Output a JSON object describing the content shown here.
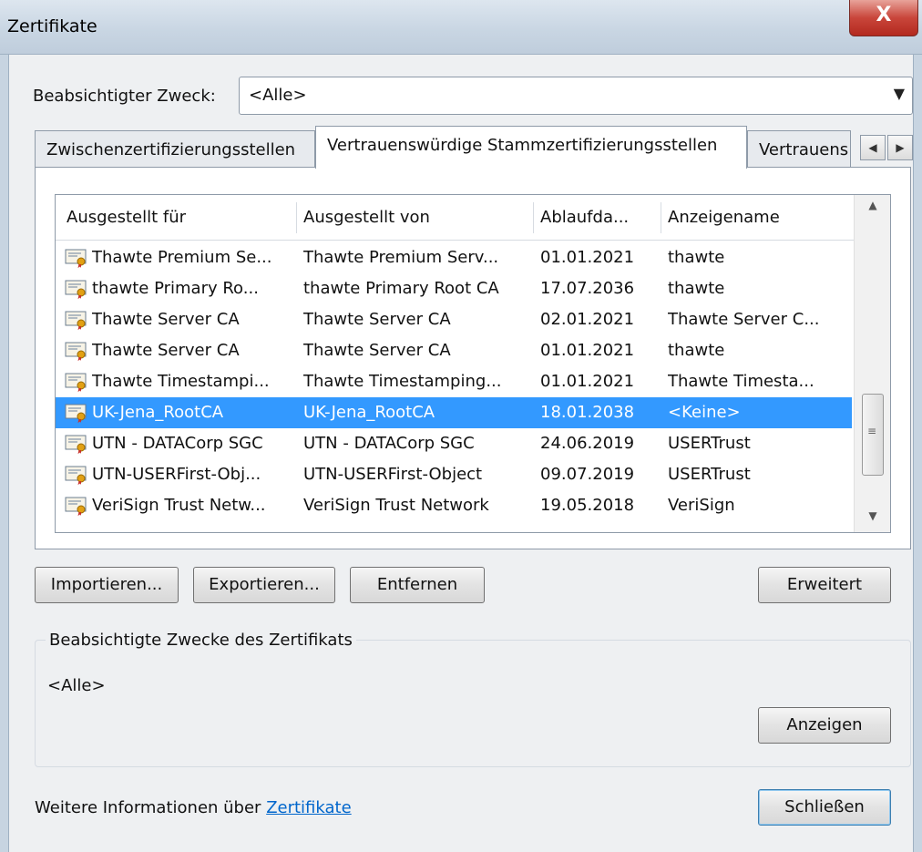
{
  "window": {
    "title": "Zertifikate",
    "close_glyph": "X"
  },
  "purpose": {
    "label": "Beabsichtigter Zweck:",
    "value": "<Alle>"
  },
  "tabs": [
    {
      "label": "Zwischenzertifizierungsstellen"
    },
    {
      "label": "Vertrauenswürdige Stammzertifizierungsstellen"
    },
    {
      "label": "Vertrauens"
    }
  ],
  "list": {
    "columns": [
      "Ausgestellt für",
      "Ausgestellt von",
      "Ablaufda...",
      "Anzeigename"
    ],
    "rows": [
      {
        "issued_to": "Thawte Premium Se...",
        "issued_by": "Thawte Premium Serv...",
        "expires": "01.01.2021",
        "name": "thawte"
      },
      {
        "issued_to": "thawte Primary Ro...",
        "issued_by": "thawte Primary Root CA",
        "expires": "17.07.2036",
        "name": "thawte"
      },
      {
        "issued_to": "Thawte Server CA",
        "issued_by": "Thawte Server CA",
        "expires": "02.01.2021",
        "name": "Thawte Server C..."
      },
      {
        "issued_to": "Thawte Server CA",
        "issued_by": "Thawte Server CA",
        "expires": "01.01.2021",
        "name": "thawte"
      },
      {
        "issued_to": "Thawte Timestampi...",
        "issued_by": "Thawte Timestamping...",
        "expires": "01.01.2021",
        "name": "Thawte Timesta..."
      },
      {
        "issued_to": "UK-Jena_RootCA",
        "issued_by": "UK-Jena_RootCA",
        "expires": "18.01.2038",
        "name": "<Keine>",
        "selected": true
      },
      {
        "issued_to": "UTN - DATACorp SGC",
        "issued_by": "UTN - DATACorp SGC",
        "expires": "24.06.2019",
        "name": "USERTrust"
      },
      {
        "issued_to": "UTN-USERFirst-Obj...",
        "issued_by": "UTN-USERFirst-Object",
        "expires": "09.07.2019",
        "name": "USERTrust"
      },
      {
        "issued_to": "VeriSign Trust Netw...",
        "issued_by": "VeriSign Trust Network",
        "expires": "19.05.2018",
        "name": "VeriSign"
      }
    ],
    "selection_color": "#3399ff"
  },
  "buttons": {
    "import": "Importieren...",
    "export": "Exportieren...",
    "remove": "Entfernen",
    "advanced": "Erweitert",
    "view": "Anzeigen",
    "close": "Schließen"
  },
  "purposes_group": {
    "title": "Beabsichtigte Zwecke des Zertifikats",
    "value": "<Alle>"
  },
  "footer": {
    "text": "Weitere Informationen über ",
    "link": "Zertifikate"
  },
  "icons": {
    "certificate": "certificate-icon",
    "dropdown": "chevron-down-icon",
    "tab_scroll_left": "arrow-left-icon",
    "tab_scroll_right": "arrow-right-icon",
    "scroll_up": "arrow-up-icon",
    "scroll_down": "arrow-down-icon"
  }
}
